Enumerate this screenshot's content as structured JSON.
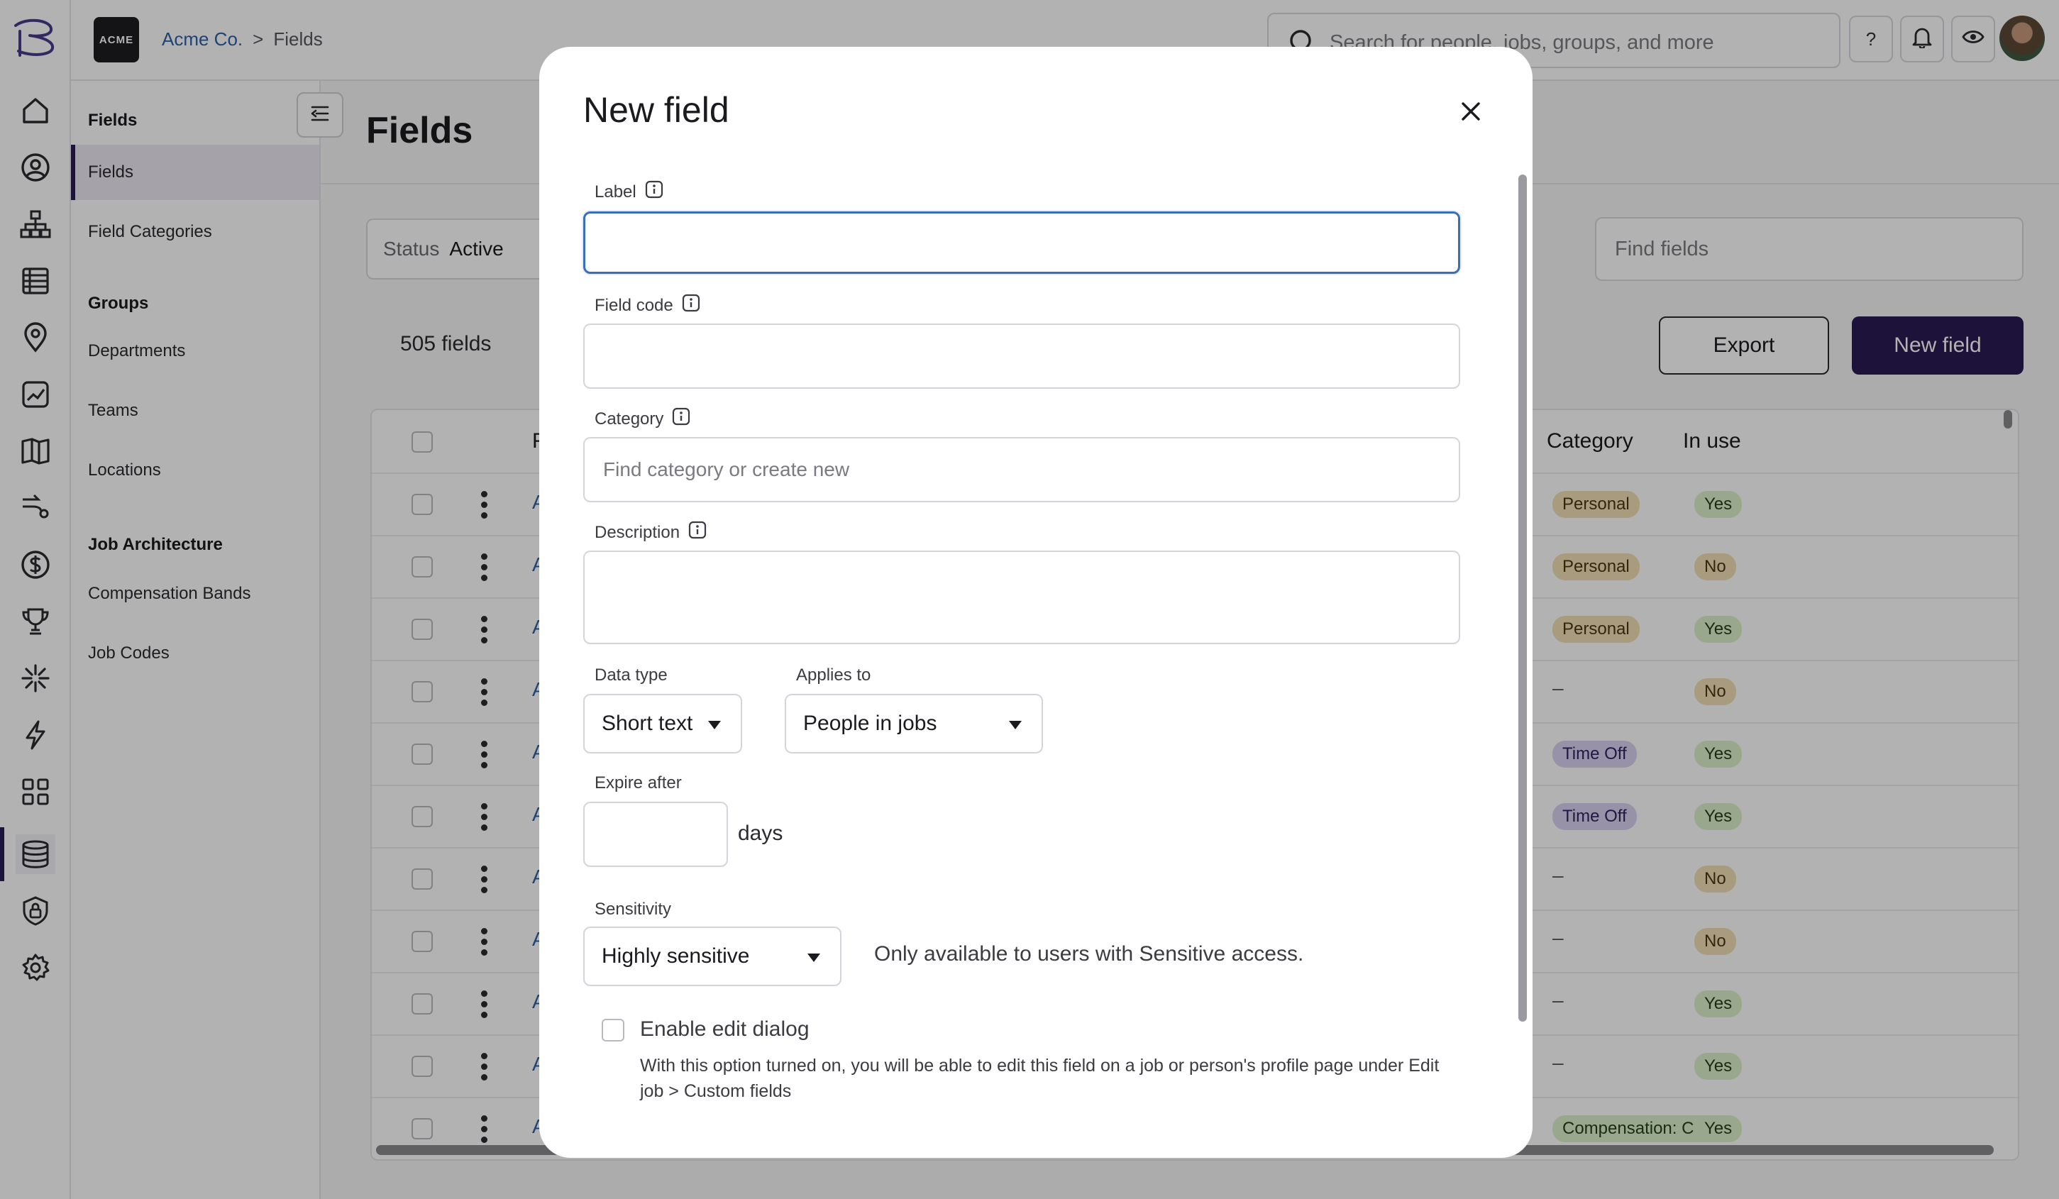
{
  "topbar": {
    "company_logo": "ACME",
    "breadcrumb": {
      "company": "Acme Co.",
      "separator": ">",
      "current": "Fields"
    },
    "search_placeholder": "Search for people, jobs, groups, and more",
    "help_label": "?"
  },
  "rail": {
    "icons": [
      "logo-icon",
      "home-icon",
      "person-icon",
      "org-chart-icon",
      "list-icon",
      "location-pin-icon",
      "chart-icon",
      "book-icon",
      "route-icon",
      "dollar-icon",
      "trophy-icon",
      "sparkle-icon",
      "lightning-icon",
      "apps-icon",
      "database-icon",
      "shield-lock-icon",
      "gear-icon"
    ],
    "active": "database-icon"
  },
  "subnav": {
    "sections": [
      {
        "heading": "Fields",
        "items": [
          "Fields",
          "Field Categories"
        ]
      },
      {
        "heading": "Groups",
        "items": [
          "Departments",
          "Teams",
          "Locations"
        ]
      },
      {
        "heading": "Job Architecture",
        "items": [
          "Compensation Bands",
          "Job Codes"
        ]
      }
    ],
    "active_item": "Fields"
  },
  "main": {
    "title": "Fields",
    "status_label": "Status",
    "status_value": "Active",
    "find_placeholder": "Find fields",
    "count": "505 fields",
    "export_label": "Export",
    "new_field_label": "New field",
    "table": {
      "first_column_partial": "F",
      "category_header": "Category",
      "in_use_header": "In use",
      "row_link_partial": "A",
      "rows": [
        {
          "category": "Personal",
          "in_use": "Yes"
        },
        {
          "category": "Personal",
          "in_use": "No"
        },
        {
          "category": "Personal",
          "in_use": "Yes"
        },
        {
          "category": "–",
          "in_use": "No"
        },
        {
          "category": "Time Off",
          "in_use": "Yes"
        },
        {
          "category": "Time Off",
          "in_use": "Yes"
        },
        {
          "category": "–",
          "in_use": "No"
        },
        {
          "category": "–",
          "in_use": "No"
        },
        {
          "category": "–",
          "in_use": "Yes"
        },
        {
          "category": "–",
          "in_use": "Yes"
        },
        {
          "category": "Compensation: Cash",
          "in_use": "Yes"
        }
      ]
    }
  },
  "modal": {
    "title": "New field",
    "label_label": "Label",
    "label_value": "",
    "field_code_label": "Field code",
    "field_code_value": "",
    "category_label": "Category",
    "category_placeholder": "Find category or create new",
    "description_label": "Description",
    "description_value": "",
    "data_type_label": "Data type",
    "data_type_value": "Short text",
    "applies_to_label": "Applies to",
    "applies_to_value": "People in jobs",
    "expire_after_label": "Expire after",
    "expire_after_value": "",
    "days_label": "days",
    "sensitivity_label": "Sensitivity",
    "sensitivity_value": "Highly sensitive",
    "sensitivity_note": "Only available to users with Sensitive access.",
    "enable_edit_label": "Enable edit dialog",
    "enable_edit_checked": false,
    "enable_edit_help": "With this option turned on, you will be able to edit this field on a job or person's profile page under Edit job > Custom fields"
  },
  "colors": {
    "brand": "#2a1a52",
    "link": "#2b61a8",
    "focus": "#3a6fb8",
    "badge_yellow": "#f3dfb4",
    "badge_green": "#dcefc9",
    "badge_purple": "#d9d2ef"
  }
}
